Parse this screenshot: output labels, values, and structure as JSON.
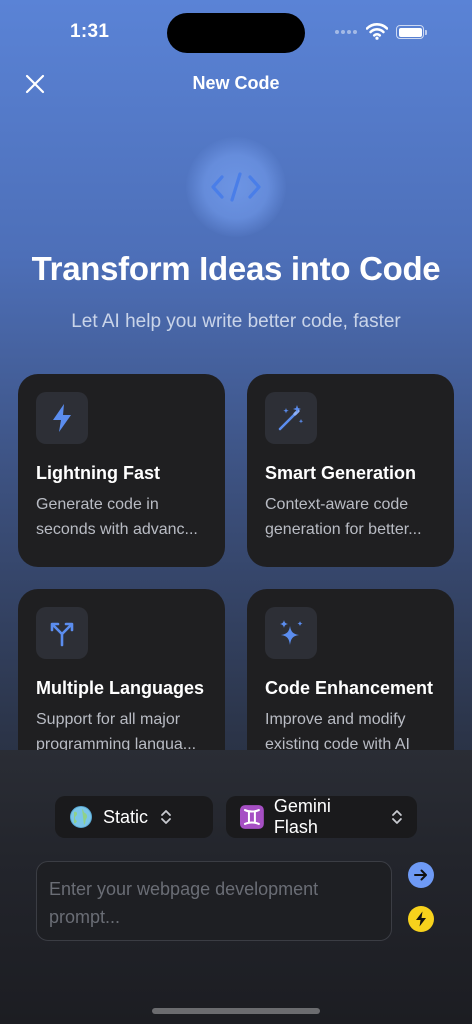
{
  "status_bar": {
    "time": "1:31"
  },
  "nav": {
    "title": "New Code"
  },
  "hero": {
    "title": "Transform Ideas into Code",
    "subtitle": "Let AI help you write better code, faster"
  },
  "features": [
    {
      "title": "Lightning Fast",
      "line1": "Generate code in",
      "line2": "seconds with advanc...",
      "icon": "lightning-icon"
    },
    {
      "title": "Smart Generation",
      "line1": "Context-aware code",
      "line2": "generation for better...",
      "icon": "magic-wand-icon"
    },
    {
      "title": "Multiple Languages",
      "line1": "Support for all major",
      "line2": "programming langua...",
      "icon": "branch-icon"
    },
    {
      "title": "Code Enhancement",
      "line1": "Improve and modify",
      "line2": "existing code with AI",
      "icon": "sparkles-icon"
    }
  ],
  "controls": {
    "mode": {
      "label": "Static",
      "icon": "globe-icon"
    },
    "model": {
      "label": "Gemini Flash",
      "icon": "gemini-icon"
    }
  },
  "prompt": {
    "placeholder": "Enter your webpage development prompt..."
  },
  "colors": {
    "accent": "#5b8def",
    "send": "#6e9af5",
    "bolt": "#f7d21c",
    "card": "#1f1f21"
  }
}
